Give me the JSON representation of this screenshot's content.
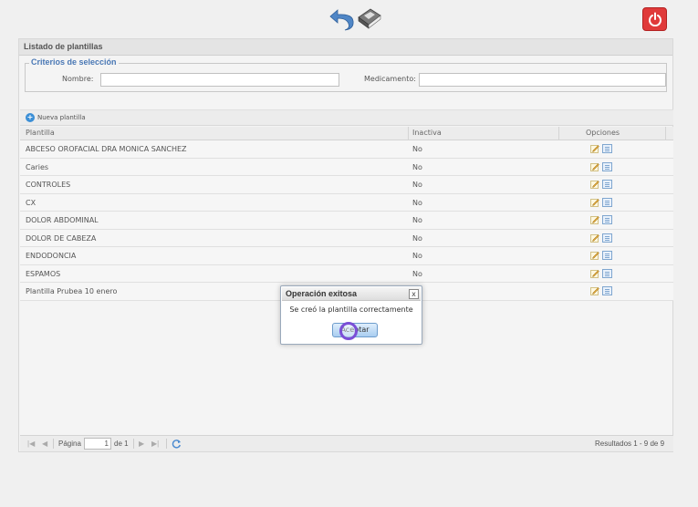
{
  "panel": {
    "title": "Listado de plantillas"
  },
  "criteria": {
    "legend": "Criterios de selección",
    "name_label": "Nombre:",
    "name_value": "",
    "med_label": "Medicamento:",
    "med_value": ""
  },
  "toolbar": {
    "new_label": "Nueva plantilla"
  },
  "grid": {
    "headers": {
      "plantilla": "Plantilla",
      "inactiva": "Inactiva",
      "opciones": "Opciones"
    },
    "rows": [
      {
        "name": "ABCESO OROFACIAL DRA MONICA SANCHEZ",
        "inactive": "No"
      },
      {
        "name": "Caries",
        "inactive": "No"
      },
      {
        "name": "CONTROLES",
        "inactive": "No"
      },
      {
        "name": "CX",
        "inactive": "No"
      },
      {
        "name": "DOLOR ABDOMINAL",
        "inactive": "No"
      },
      {
        "name": "DOLOR DE CABEZA",
        "inactive": "No"
      },
      {
        "name": "ENDODONCIA",
        "inactive": "No"
      },
      {
        "name": "ESPAMOS",
        "inactive": "No"
      },
      {
        "name": "Plantilla Prubea 10 enero",
        "inactive": ""
      }
    ]
  },
  "pager": {
    "page_label": "Página",
    "page_value": "1",
    "of_label": "de 1",
    "results": "Resultados 1 - 9 de 9"
  },
  "dialog": {
    "title": "Operación exitosa",
    "close": "x",
    "message": "Se creó la plantilla correctamente",
    "button": "Aceptar"
  },
  "colors": {
    "accent": "#4a78b5",
    "power": "#e03a3a"
  }
}
